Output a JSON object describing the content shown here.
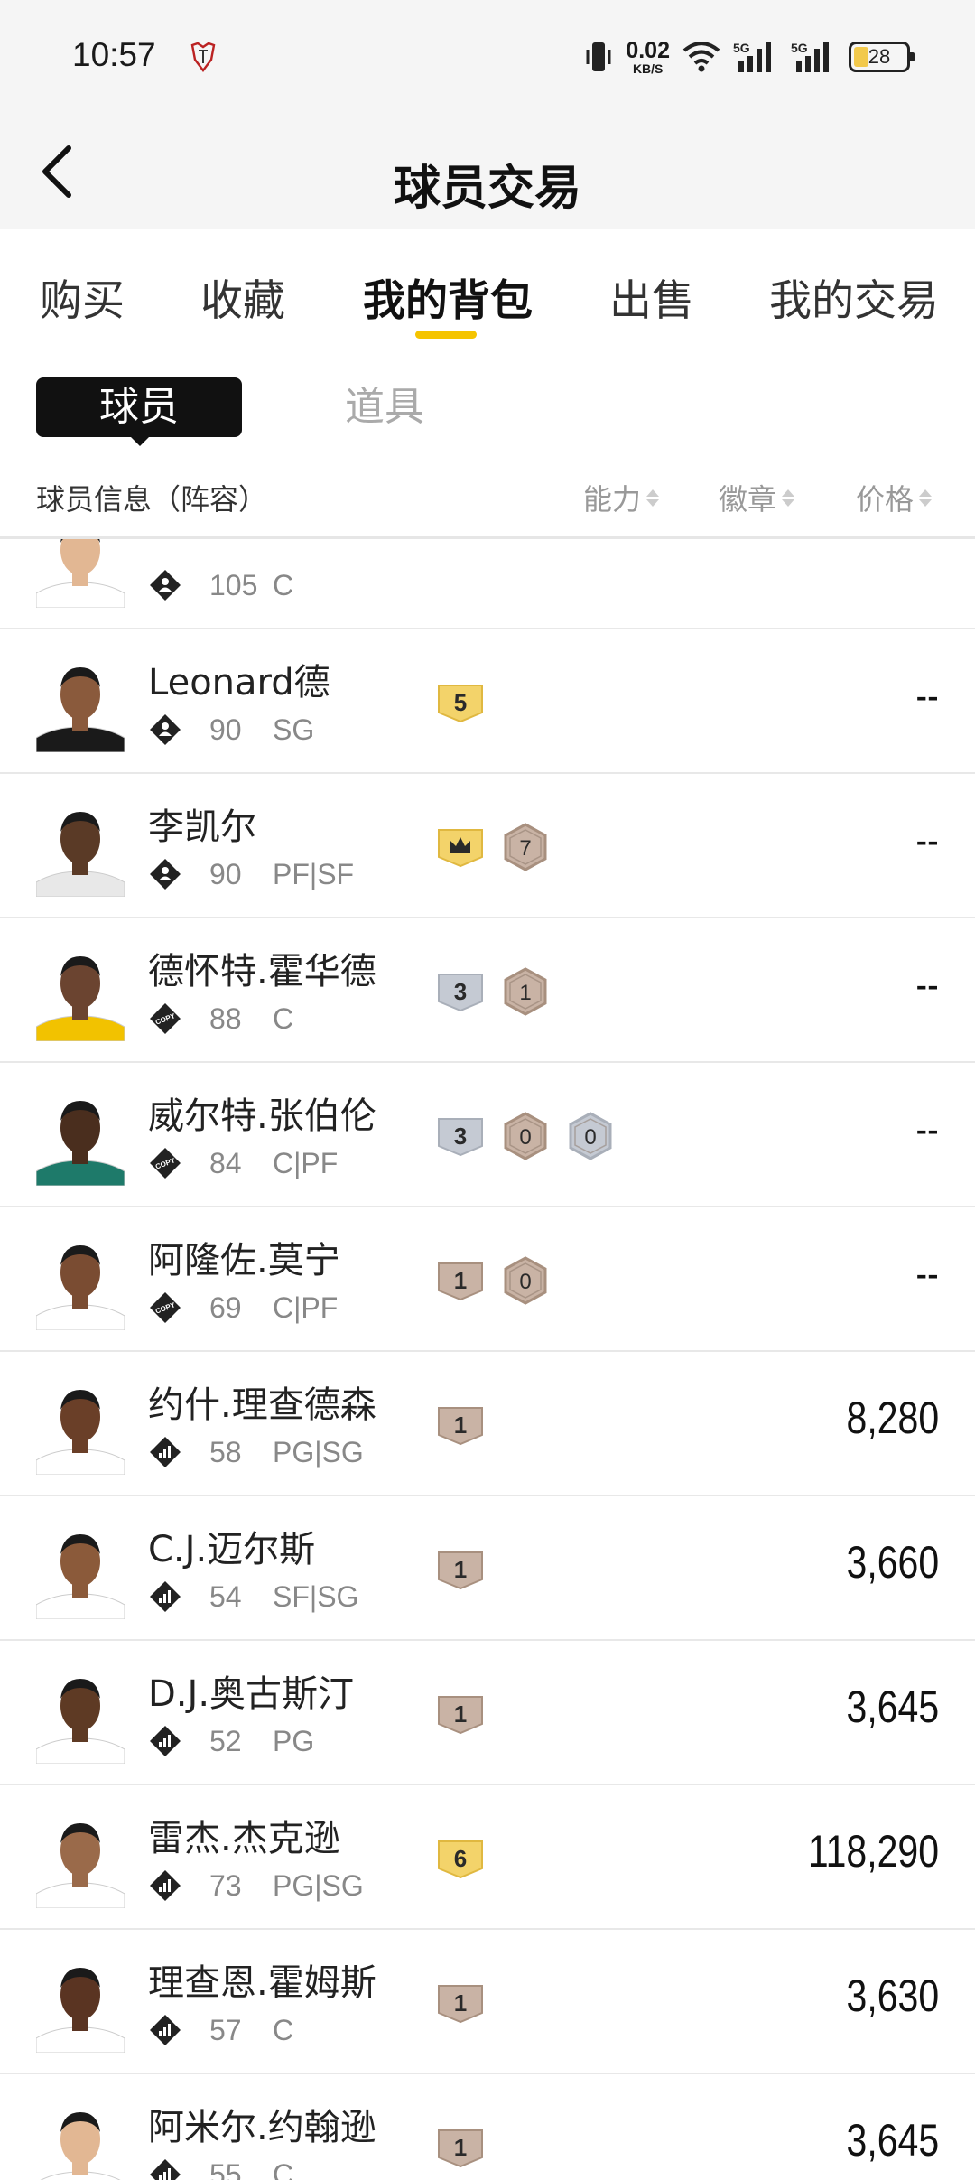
{
  "status": {
    "time": "10:57",
    "net_speed_value": "0.02",
    "net_speed_unit": "KB/S",
    "signal1": "5G",
    "signal2": "5G",
    "battery": "28"
  },
  "nav": {
    "title": "球员交易"
  },
  "tabs": [
    "购买",
    "收藏",
    "我的背包",
    "出售",
    "我的交易"
  ],
  "active_tab": "我的背包",
  "segments": {
    "player": "球员",
    "item": "道具"
  },
  "list_header": {
    "info": "球员信息（阵容）",
    "ability": "能力",
    "badge": "徽章",
    "price": "价格"
  },
  "players": [
    {
      "name": "",
      "ovr": "105",
      "pos": "C",
      "tier": "person",
      "badges": [],
      "price": ""
    },
    {
      "name": "Leonard德",
      "ovr": "90",
      "pos": "SG",
      "tier": "person",
      "badges": [
        {
          "type": "gold",
          "label": "5"
        }
      ],
      "price": "--"
    },
    {
      "name": "李凯尔",
      "ovr": "90",
      "pos": "PF|SF",
      "tier": "person",
      "badges": [
        {
          "type": "crown",
          "label": ""
        },
        {
          "type": "hex-bronze",
          "label": "7"
        }
      ],
      "price": "--"
    },
    {
      "name": "德怀特.霍华德",
      "ovr": "88",
      "pos": "C",
      "tier": "copy",
      "badges": [
        {
          "type": "silver",
          "label": "3"
        },
        {
          "type": "hex-bronze",
          "label": "1"
        }
      ],
      "price": "--"
    },
    {
      "name": "威尔特.张伯伦",
      "ovr": "84",
      "pos": "C|PF",
      "tier": "copy",
      "badges": [
        {
          "type": "silver",
          "label": "3"
        },
        {
          "type": "hex-bronze",
          "label": "0"
        },
        {
          "type": "hex-silver",
          "label": "0"
        }
      ],
      "price": "--"
    },
    {
      "name": "阿隆佐.莫宁",
      "ovr": "69",
      "pos": "C|PF",
      "tier": "copy",
      "badges": [
        {
          "type": "bronze",
          "label": "1"
        },
        {
          "type": "hex-bronze",
          "label": "0"
        }
      ],
      "price": "--"
    },
    {
      "name": "约什.理查德森",
      "ovr": "58",
      "pos": "PG|SG",
      "tier": "bars",
      "badges": [
        {
          "type": "bronze",
          "label": "1"
        }
      ],
      "price": "8,280"
    },
    {
      "name": "C.J.迈尔斯",
      "ovr": "54",
      "pos": "SF|SG",
      "tier": "bars",
      "badges": [
        {
          "type": "bronze",
          "label": "1"
        }
      ],
      "price": "3,660"
    },
    {
      "name": "D.J.奥古斯汀",
      "ovr": "52",
      "pos": "PG",
      "tier": "bars",
      "badges": [
        {
          "type": "bronze",
          "label": "1"
        }
      ],
      "price": "3,645"
    },
    {
      "name": "雷杰.杰克逊",
      "ovr": "73",
      "pos": "PG|SG",
      "tier": "bars",
      "badges": [
        {
          "type": "gold",
          "label": "6"
        }
      ],
      "price": "118,290"
    },
    {
      "name": "理查恩.霍姆斯",
      "ovr": "57",
      "pos": "C",
      "tier": "bars",
      "badges": [
        {
          "type": "bronze",
          "label": "1"
        }
      ],
      "price": "3,630"
    },
    {
      "name": "阿米尔.约翰逊",
      "ovr": "55",
      "pos": "C",
      "tier": "bars",
      "badges": [
        {
          "type": "bronze",
          "label": "1"
        }
      ],
      "price": "3,645"
    }
  ],
  "colors": {
    "accent": "#f5c400",
    "gold": "#f3d36a",
    "silver": "#c5cad3",
    "bronze": "#c9b3a5"
  }
}
